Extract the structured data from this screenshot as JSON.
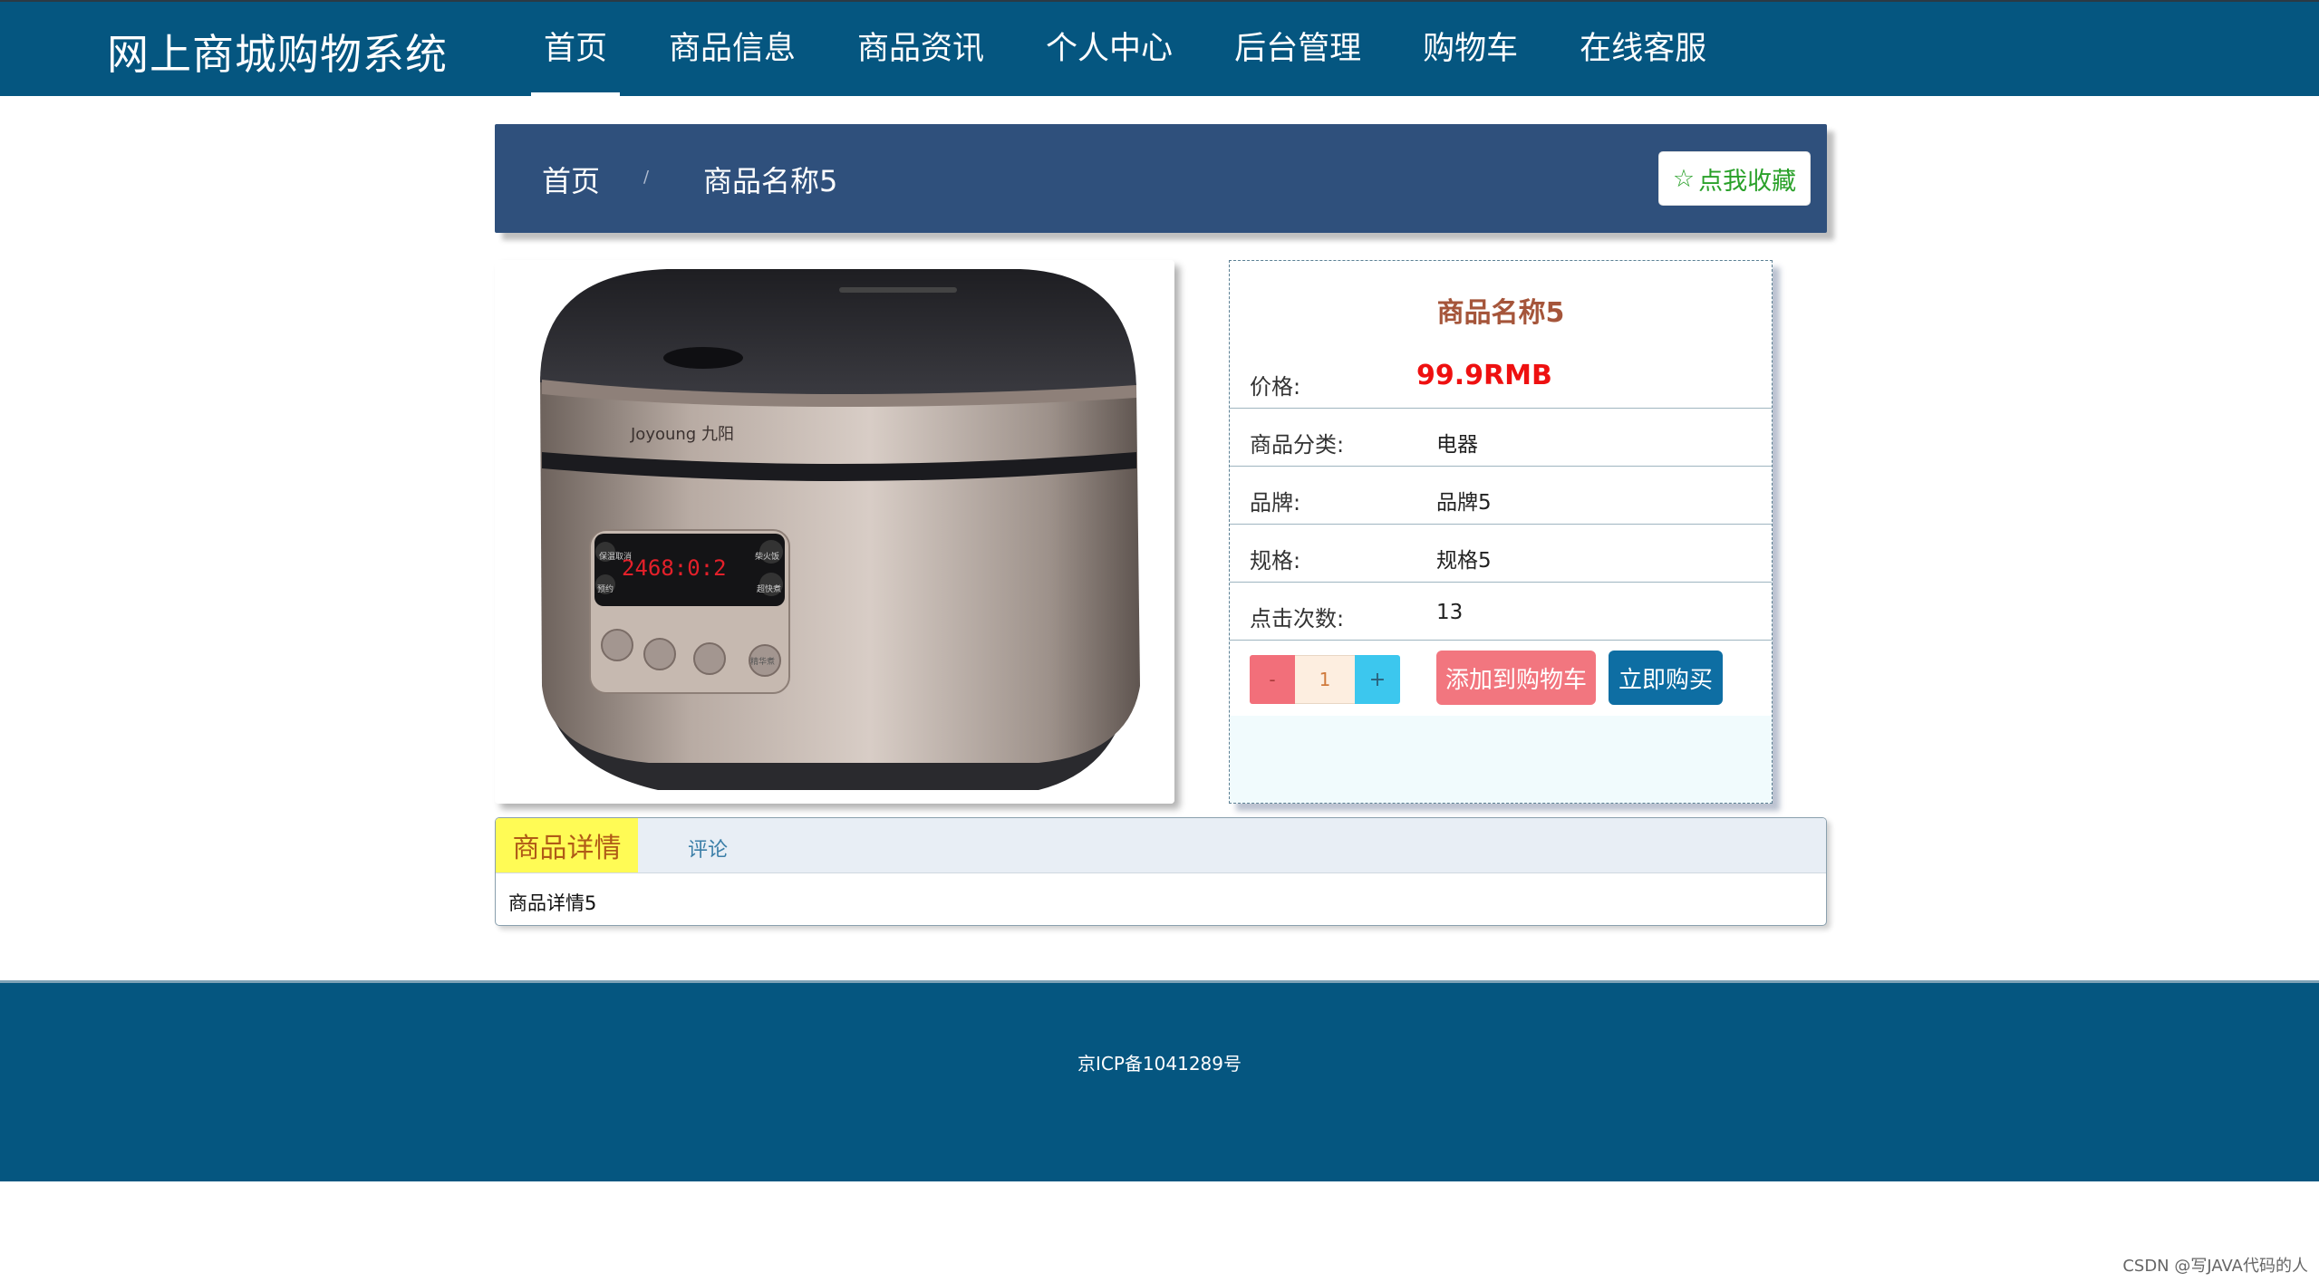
{
  "header": {
    "brand": "网上商城购物系统",
    "nav": [
      "首页",
      "商品信息",
      "商品资讯",
      "个人中心",
      "后台管理",
      "购物车",
      "在线客服"
    ]
  },
  "breadcrumb": {
    "home": "首页",
    "separator": "/",
    "current": "商品名称5",
    "favorite_label": "点我收藏"
  },
  "product": {
    "name": "商品名称5",
    "price_label": "价格:",
    "price": "99.9RMB",
    "category_label": "商品分类:",
    "category": "电器",
    "brand_label": "品牌:",
    "brand": "品牌5",
    "spec_label": "规格:",
    "spec": "规格5",
    "clicks_label": "点击次数:",
    "clicks": "13",
    "image_panel": {
      "brand_text": "Joyoung 九阳",
      "display_digits": "2468:0:2",
      "button_labels": [
        "保温取消",
        "预约",
        "柴火饭",
        "超快煮",
        "精华煮"
      ]
    }
  },
  "quantity": {
    "minus": "-",
    "value": "1",
    "plus": "+"
  },
  "actions": {
    "add_to_cart": "添加到购物车",
    "buy_now": "立即购买"
  },
  "tabs": {
    "detail": "商品详情",
    "comment": "评论"
  },
  "detail_text": "商品详情5",
  "footer": {
    "icp": "京ICP备1041289号"
  },
  "watermark": "CSDN @写JAVA代码的人",
  "colors": {
    "nav_bg": "#055680",
    "crumb_bg": "#2f507c",
    "price": "#ee1010",
    "accent_yellow": "#fffb55"
  }
}
